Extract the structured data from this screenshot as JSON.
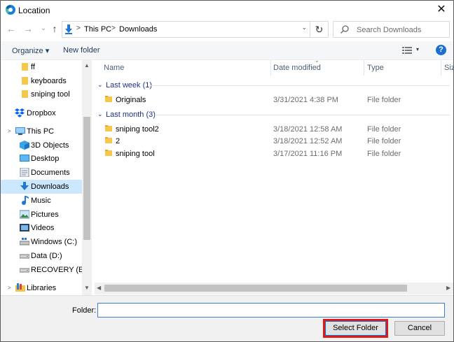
{
  "window": {
    "title": "Location",
    "close_glyph": "✕"
  },
  "address": {
    "back_glyph": "←",
    "forward_glyph": "→",
    "recent_glyph": "⌄",
    "up_glyph": "↑",
    "crumbs": [
      "This PC",
      "Downloads"
    ],
    "crumb_sep": ">",
    "dropdown_glyph": "⌄",
    "refresh_glyph": "↻"
  },
  "search": {
    "placeholder": "Search Downloads"
  },
  "toolbar": {
    "organize": "Organize ▾",
    "new_folder": "New folder",
    "help": "?",
    "view_dd": "▾"
  },
  "navpane": {
    "expander_glyph": ">",
    "items": [
      {
        "label": "ff",
        "icon": "folder-icon"
      },
      {
        "label": "keyboards",
        "icon": "folder-icon"
      },
      {
        "label": "sniping tool",
        "icon": "folder-icon"
      },
      {
        "label": "Dropbox",
        "icon": "dropbox-icon"
      },
      {
        "label": "This PC",
        "icon": "computer-icon"
      },
      {
        "label": "3D Objects",
        "icon": "3d-objects-icon"
      },
      {
        "label": "Desktop",
        "icon": "desktop-icon"
      },
      {
        "label": "Documents",
        "icon": "documents-icon"
      },
      {
        "label": "Downloads",
        "icon": "downloads-icon",
        "selected": true
      },
      {
        "label": "Music",
        "icon": "music-icon"
      },
      {
        "label": "Pictures",
        "icon": "pictures-icon"
      },
      {
        "label": "Videos",
        "icon": "videos-icon"
      },
      {
        "label": "Windows (C:)",
        "icon": "drive-icon"
      },
      {
        "label": "Data (D:)",
        "icon": "drive-icon"
      },
      {
        "label": "RECOVERY (E:)",
        "icon": "drive-icon"
      },
      {
        "label": "Libraries",
        "icon": "libraries-icon"
      }
    ]
  },
  "columns": {
    "name": "Name",
    "date": "Date modified",
    "type": "Type",
    "size": "Siz"
  },
  "groups": [
    {
      "label": "Last week (1)",
      "chevron": "⌄",
      "rows": [
        {
          "name": "Originals",
          "date": "3/31/2021 4:38 PM",
          "type": "File folder"
        }
      ]
    },
    {
      "label": "Last month (3)",
      "chevron": "⌄",
      "rows": [
        {
          "name": "sniping tool2",
          "date": "3/18/2021 12:58 AM",
          "type": "File folder"
        },
        {
          "name": "2",
          "date": "3/18/2021 12:52 AM",
          "type": "File folder"
        },
        {
          "name": "sniping tool",
          "date": "3/17/2021 11:16 PM",
          "type": "File folder"
        }
      ]
    }
  ],
  "scroll": {
    "up": "▲",
    "down": "▼",
    "left": "◀",
    "right": "▶"
  },
  "footer": {
    "folder_label": "Folder:",
    "folder_value": "",
    "select_button": "Select Folder",
    "cancel_button": "Cancel"
  },
  "colors": {
    "selection": "#cce8ff",
    "highlight_box": "#e01818",
    "accent": "#0078d7"
  }
}
